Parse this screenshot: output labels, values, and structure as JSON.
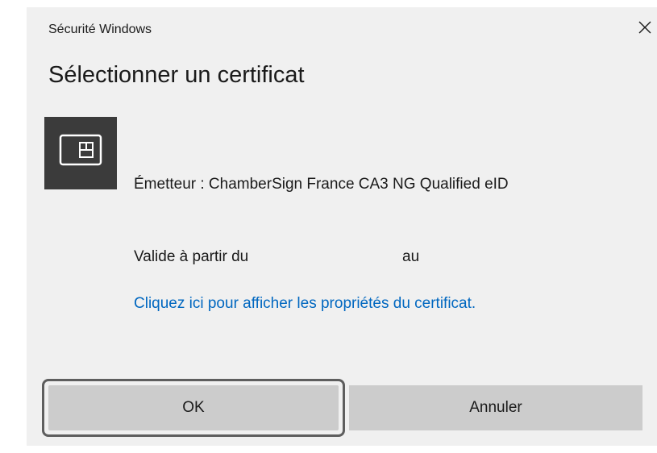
{
  "window": {
    "title": "Sécurité Windows",
    "close_icon": "close-icon"
  },
  "dialog": {
    "heading": "Sélectionner un certificat"
  },
  "certificate": {
    "icon": "smart-card-icon",
    "issuer": "Émetteur : ChamberSign France CA3 NG Qualified eID",
    "valid_from_label": "Valide à partir du",
    "valid_to_label": "au",
    "properties_link": "Cliquez ici pour afficher les propriétés du certificat."
  },
  "buttons": {
    "ok_label": "OK",
    "cancel_label": "Annuler"
  },
  "colors": {
    "dialog_background": "#f0f0f0",
    "link": "#0067c0",
    "button_fill": "#cccccc",
    "focus_ring": "#5e5e5e",
    "icon_tile": "#3b3b3b"
  }
}
